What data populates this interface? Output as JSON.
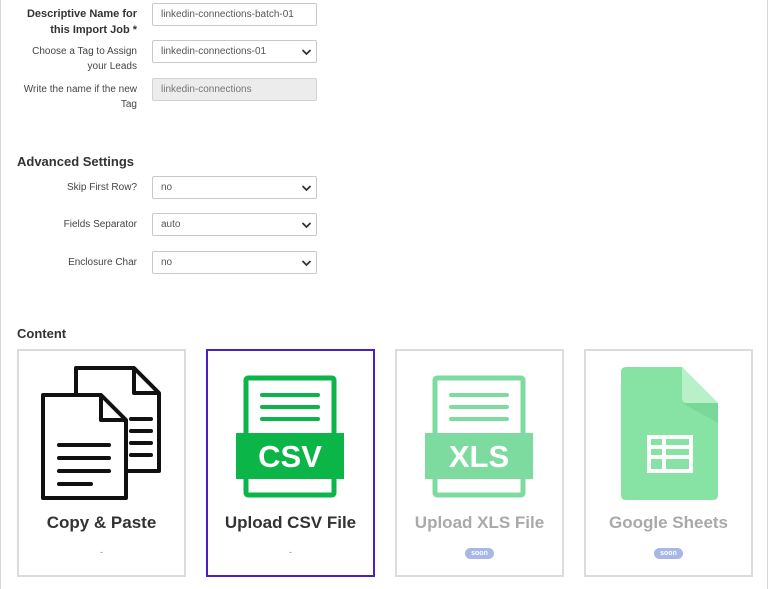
{
  "form": {
    "import_name": {
      "label_line1": "Descriptive Name for",
      "label_line2": "this Import Job *",
      "value": "linkedin-connections-batch-01"
    },
    "tag_select": {
      "label_line1": "Choose a Tag to Assign",
      "label_line2": "your Leads",
      "value": "linkedin-connections-01"
    },
    "new_tag": {
      "label_line1": "Write the name if the new",
      "label_line2": "Tag",
      "placeholder": "linkedin-connections"
    }
  },
  "advanced": {
    "title": "Advanced Settings",
    "skip_first_row": {
      "label": "Skip First Row?",
      "value": "no"
    },
    "fields_separator": {
      "label": "Fields Separator",
      "value": "auto"
    },
    "enclosure_char": {
      "label": "Enclosure Char",
      "value": "no"
    }
  },
  "content": {
    "title": "Content",
    "cards": [
      {
        "title": "Copy & Paste",
        "sub": "-",
        "icon": "documents-icon"
      },
      {
        "title": "Upload CSV File",
        "sub": "-",
        "icon": "csv-file-icon",
        "selected": true,
        "art_text": "CSV"
      },
      {
        "title": "Upload XLS File",
        "badge": "soon",
        "icon": "xls-file-icon",
        "art_text": "XLS"
      },
      {
        "title": "Google Sheets",
        "badge": "soon",
        "icon": "google-sheets-icon"
      }
    ]
  },
  "colors": {
    "csv_green": "#0bb548",
    "xls_green": "#7edba0",
    "sheets_green": "#86e3a3",
    "selected_border": "#4b1fc2",
    "badge": "#a7b8e6"
  }
}
